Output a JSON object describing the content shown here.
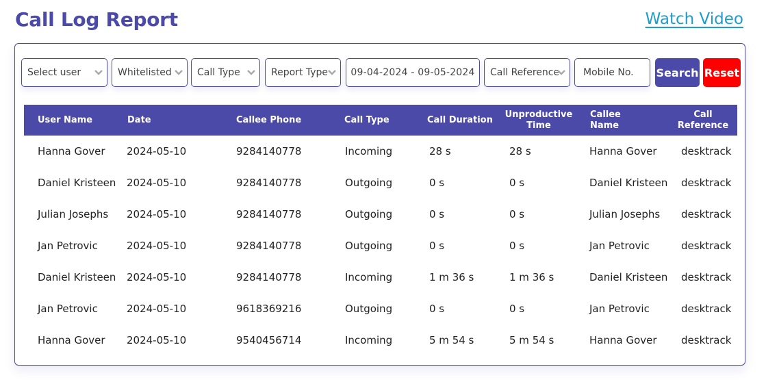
{
  "header": {
    "title": "Call Log Report",
    "watch_video": "Watch Video"
  },
  "filters": {
    "select_user": "Select user",
    "whitelisted": "Whitelisted",
    "call_type": "Call Type",
    "report_type": "Report Type",
    "date_range": "09-04-2024 - 09-05-2024",
    "call_reference": "Call Reference",
    "mobile_placeholder": "Mobile No.",
    "search_label": "Search",
    "reset_label": "Reset"
  },
  "colors": {
    "primary": "#4b4aa8",
    "reset": "#ff0000",
    "link": "#1f9ccc"
  },
  "table": {
    "columns": [
      "User Name",
      "Date",
      "Callee Phone",
      "Call Type",
      "Call Duration",
      "Unproductive Time",
      "Callee Name",
      "Call Reference"
    ],
    "header_lines": {
      "unproductive_1": "Unproductive",
      "unproductive_2": "Time",
      "callee_name_1": "Callee",
      "callee_name_2": "Name",
      "call_reference_1": "Call",
      "call_reference_2": "Reference"
    },
    "rows": [
      {
        "user": "Hanna Gover",
        "date": "2024-05-10",
        "phone": "9284140778",
        "type": "Incoming",
        "duration": "28 s",
        "unproductive": "28 s",
        "callee": "Hanna Gover",
        "reference": "desktrack"
      },
      {
        "user": "Daniel Kristeen",
        "date": "2024-05-10",
        "phone": "9284140778",
        "type": "Outgoing",
        "duration": "0 s",
        "unproductive": "0 s",
        "callee": "Daniel Kristeen",
        "reference": "desktrack"
      },
      {
        "user": "Julian Josephs",
        "date": "2024-05-10",
        "phone": "9284140778",
        "type": "Outgoing",
        "duration": "0 s",
        "unproductive": "0 s",
        "callee": "Julian Josephs",
        "reference": "desktrack"
      },
      {
        "user": "Jan Petrovic",
        "date": "2024-05-10",
        "phone": "9284140778",
        "type": "Outgoing",
        "duration": "0 s",
        "unproductive": "0 s",
        "callee": "Jan Petrovic",
        "reference": "desktrack"
      },
      {
        "user": "Daniel Kristeen",
        "date": "2024-05-10",
        "phone": "9284140778",
        "type": "Incoming",
        "duration": "1 m 36 s",
        "unproductive": "1 m 36 s",
        "callee": "Daniel Kristeen",
        "reference": "desktrack"
      },
      {
        "user": "Jan Petrovic",
        "date": "2024-05-10",
        "phone": "9618369216",
        "type": "Outgoing",
        "duration": "0 s",
        "unproductive": "0 s",
        "callee": "Jan Petrovic",
        "reference": "desktrack"
      },
      {
        "user": "Hanna Gover",
        "date": "2024-05-10",
        "phone": "9540456714",
        "type": "Incoming",
        "duration": "5 m 54 s",
        "unproductive": "5 m 54 s",
        "callee": "Hanna Gover",
        "reference": "desktrack"
      }
    ]
  }
}
